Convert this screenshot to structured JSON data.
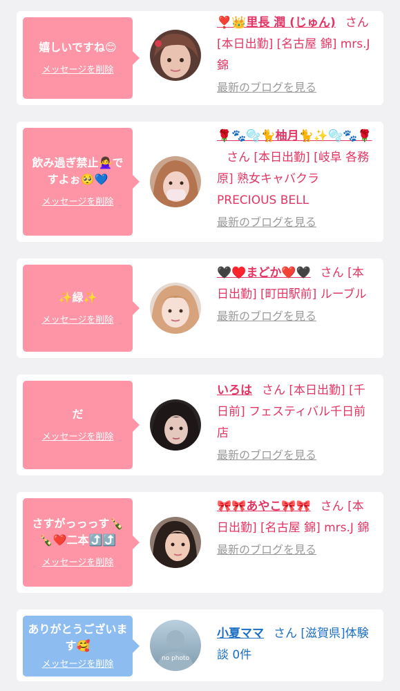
{
  "colors": {
    "page_bg": "#f1f1f3",
    "pink_bubble": "#fd95a7",
    "blue_bubble": "#8dbcf1",
    "pink_text": "#e23563",
    "blue_text": "#1c6fc3",
    "link_gray": "#9a9a9a"
  },
  "messages": [
    {
      "comment": "嬉しいですね😊",
      "delete_label": "メッセージを削除",
      "name": "❣️👑里長 潤 (じゅん)",
      "san": "さん",
      "details": "[本日出勤] [名古屋 錦] mrs.J 錦",
      "blog_link": "最新のブログを見る",
      "avatar_icon": "cast-photo-avatar"
    },
    {
      "comment": "飲み過ぎ禁止🙅‍♀️ですよぉ🥺💙",
      "delete_label": "メッセージを削除",
      "name": "🌹🐾🫧🐈柚月🐈✨🫧🐾🌹",
      "san": "さん",
      "details": "[本日出勤] [岐阜 各務原] 熟女キャバクラ PRECIOUS BELL",
      "blog_link": "最新のブログを見る",
      "avatar_icon": "cast-photo-avatar"
    },
    {
      "comment": "✨緑✨",
      "delete_label": "メッセージを削除",
      "name": "🖤♥️まどか❤️🖤",
      "san": "さん",
      "details": "[本日出勤] [町田駅前] ルーブル",
      "blog_link": "最新のブログを見る",
      "avatar_icon": "cast-photo-avatar"
    },
    {
      "comment": "だ",
      "delete_label": "メッセージを削除",
      "name": "いろは",
      "san": "さん",
      "details": "[本日出勤] [千日前] フェスティバル千日前店",
      "blog_link": "最新のブログを見る",
      "avatar_icon": "cast-photo-avatar"
    },
    {
      "comment": "さすがっっっす🍾🍾❤️二本⤴️⤴️",
      "delete_label": "メッセージを削除",
      "name": "🎀🎀あやこ🎀🎀",
      "san": "さん",
      "details": "[本日出勤] [名古屋 錦] mrs.J 錦",
      "blog_link": "最新のブログを見る",
      "avatar_icon": "cast-photo-avatar"
    },
    {
      "comment": "ありがとうございます🥰",
      "delete_label": "メッセージを削除",
      "name": "小夏ママ",
      "san": "さん",
      "details": "[滋賀県]体験談 0件",
      "avatar_icon": "no-photo-avatar",
      "avatar_text": "no photo"
    }
  ]
}
